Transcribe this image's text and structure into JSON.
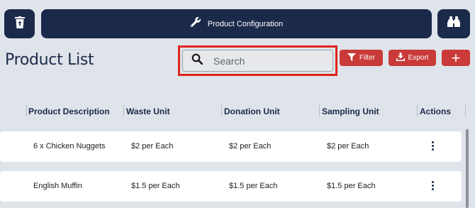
{
  "toolbar": {
    "config_label": "Product Configuration"
  },
  "page": {
    "title": "Product List"
  },
  "search": {
    "placeholder": "Search"
  },
  "actions": {
    "filter_label": "Filter",
    "export_label": "Export",
    "add_label": "+"
  },
  "table": {
    "columns": [
      "Product Description",
      "Waste Unit",
      "Donation Unit",
      "Sampling Unit",
      "Actions"
    ],
    "rows": [
      {
        "description": "6 x Chicken Nuggets",
        "waste": "$2 per Each",
        "donation": "$2 per Each",
        "sampling": "$2 per Each"
      },
      {
        "description": "English Muffin",
        "waste": "$1.5 per Each",
        "donation": "$1.5 per Each",
        "sampling": "$1.5 per Each"
      }
    ]
  },
  "icons": {
    "trash": "trash-icon",
    "wrench": "wrench-icon",
    "binoculars": "binoculars-icon",
    "search": "search-icon",
    "filter": "filter-icon",
    "export": "download-icon",
    "row_actions": "more-vertical-icon"
  },
  "colors": {
    "navy": "#1b2a4a",
    "accent_red": "#c93a38",
    "highlight": "#e0241b",
    "background": "#dfe3ea"
  }
}
